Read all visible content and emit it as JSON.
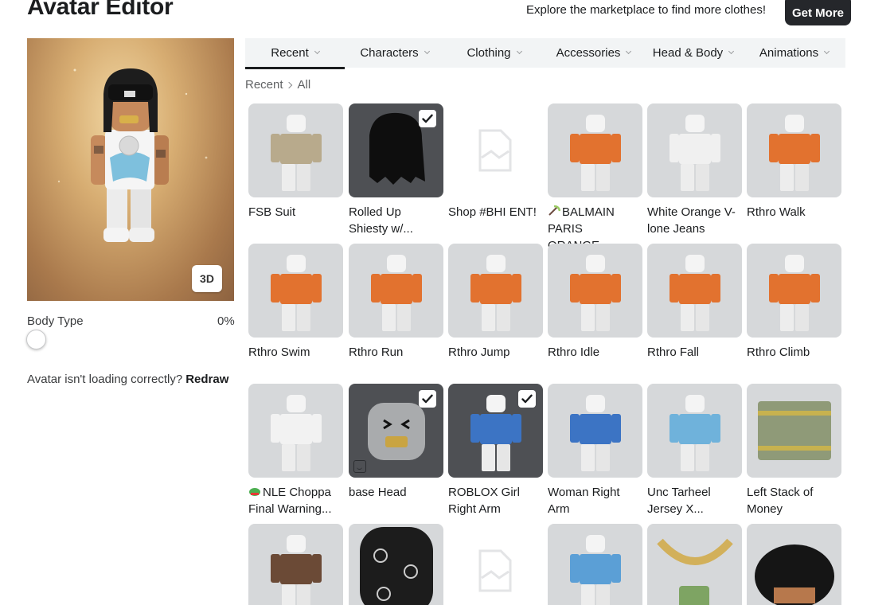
{
  "header": {
    "title": "Avatar Editor",
    "promo_text": "Explore the marketplace to find more clothes!",
    "get_more_label": "Get More"
  },
  "preview": {
    "mode_button": "3D"
  },
  "body_type": {
    "label": "Body Type",
    "value": "0%",
    "fraction": 0
  },
  "loading_help": {
    "text": "Avatar isn't loading correctly?",
    "link": "Redraw"
  },
  "tabs": [
    {
      "label": "Recent",
      "active": true
    },
    {
      "label": "Characters"
    },
    {
      "label": "Clothing"
    },
    {
      "label": "Accessories"
    },
    {
      "label": "Head & Body"
    },
    {
      "label": "Animations"
    }
  ],
  "breadcrumb": {
    "root": "Recent",
    "current": "All"
  },
  "items": [
    {
      "line1": "FSB Suit",
      "line2": "",
      "equipped": false,
      "thumb": "suit"
    },
    {
      "line1": "Rolled Up",
      "line2": "Shiesty w/...",
      "equipped": true,
      "thumb": "hat"
    },
    {
      "line1": "Shop #BHI ENT!",
      "line2": "",
      "equipped": false,
      "thumb": "placeholder"
    },
    {
      "line1": "BALMAIN",
      "line2": "PARIS ORANGE...",
      "equipped": false,
      "thumb": "orange-shirt",
      "prefix_icon": "pickaxe-emoji-icon"
    },
    {
      "line1": "White Orange V-",
      "line2": "lone Jeans",
      "equipped": false,
      "thumb": "jeans"
    },
    {
      "line1": "Rthro Walk",
      "line2": "",
      "equipped": false,
      "thumb": "walk"
    },
    {
      "line1": "Rthro Swim",
      "line2": "",
      "equipped": false,
      "thumb": "swim"
    },
    {
      "line1": "Rthro Run",
      "line2": "",
      "equipped": false,
      "thumb": "run"
    },
    {
      "line1": "Rthro Jump",
      "line2": "",
      "equipped": false,
      "thumb": "jump"
    },
    {
      "line1": "Rthro Idle",
      "line2": "",
      "equipped": false,
      "thumb": "idle"
    },
    {
      "line1": "Rthro Fall",
      "line2": "",
      "equipped": false,
      "thumb": "fall"
    },
    {
      "line1": "Rthro Climb",
      "line2": "",
      "equipped": false,
      "thumb": "climb"
    },
    {
      "line1": "NLE Choppa",
      "line2": "Final Warning...",
      "equipped": false,
      "thumb": "plain",
      "prefix_icon": "frog-emoji-icon"
    },
    {
      "line1": "base Head",
      "line2": "",
      "equipped": true,
      "thumb": "head"
    },
    {
      "line1": "ROBLOX Girl",
      "line2": "Right Arm",
      "equipped": true,
      "thumb": "arm-dark"
    },
    {
      "line1": "Woman Right",
      "line2": "Arm",
      "equipped": false,
      "thumb": "arm-light"
    },
    {
      "line1": "Unc Tarheel",
      "line2": "Jersey X...",
      "equipped": false,
      "thumb": "jersey"
    },
    {
      "line1": "Left Stack of",
      "line2": "Money",
      "equipped": false,
      "thumb": "money"
    },
    {
      "line1": "",
      "line2": "",
      "equipped": false,
      "thumb": "brown-jacket"
    },
    {
      "line1": "",
      "line2": "",
      "equipped": false,
      "thumb": "lv-mask"
    },
    {
      "line1": "",
      "line2": "",
      "equipped": false,
      "thumb": "placeholder"
    },
    {
      "line1": "",
      "line2": "",
      "equipped": false,
      "thumb": "blue-shirt"
    },
    {
      "line1": "",
      "line2": "",
      "equipped": false,
      "thumb": "chain"
    },
    {
      "line1": "",
      "line2": "",
      "equipped": false,
      "thumb": "hair"
    }
  ]
}
